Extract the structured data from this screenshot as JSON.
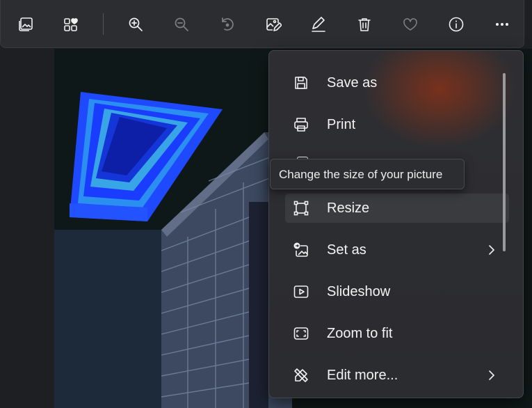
{
  "toolbar": {
    "buttons": [
      {
        "icon": "gallery-icon",
        "state": "enabled"
      },
      {
        "icon": "add-to-favorites-collection-icon",
        "state": "enabled"
      },
      {
        "icon": "zoom-in-icon",
        "state": "enabled"
      },
      {
        "icon": "zoom-out-icon",
        "state": "disabled"
      },
      {
        "icon": "rotate-icon",
        "state": "disabled"
      },
      {
        "icon": "edit-image-icon",
        "state": "enabled"
      },
      {
        "icon": "draw-icon",
        "state": "enabled"
      },
      {
        "icon": "delete-icon",
        "state": "enabled"
      },
      {
        "icon": "favorite-heart-icon",
        "state": "disabled"
      },
      {
        "icon": "info-icon",
        "state": "enabled"
      },
      {
        "icon": "more-options-icon",
        "state": "enabled"
      }
    ]
  },
  "menu": {
    "items": [
      {
        "label": "Save as",
        "icon": "save-icon"
      },
      {
        "label": "Print",
        "icon": "print-icon"
      },
      {
        "label": "Resize",
        "icon": "resize-icon",
        "hovered": true
      },
      {
        "label": "Set as",
        "icon": "set-as-icon",
        "submenu": true
      },
      {
        "label": "Slideshow",
        "icon": "slideshow-icon"
      },
      {
        "label": "Zoom to fit",
        "icon": "zoom-to-fit-icon"
      },
      {
        "label": "Edit more...",
        "icon": "edit-more-icon",
        "submenu": true
      }
    ]
  },
  "tooltip": {
    "text": "Change the size of your picture"
  },
  "colors": {
    "toolbar_bg": "#2c2d31",
    "menu_bg": "#2e2e32",
    "menu_hover": "#3a3b3f",
    "text": "#f3f3f3",
    "skylight_blue": "#1a3cff"
  }
}
